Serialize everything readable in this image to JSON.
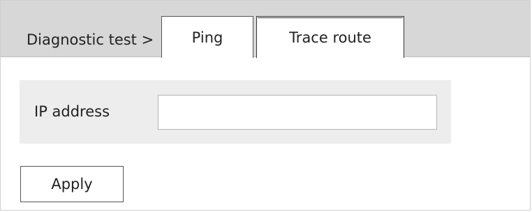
{
  "header": {
    "breadcrumb": "Diagnostic test >",
    "tabs": [
      {
        "label": "Ping",
        "active": false
      },
      {
        "label": "Trace route",
        "active": true
      }
    ]
  },
  "form": {
    "ip_label": "IP address",
    "ip_value": "",
    "ip_placeholder": ""
  },
  "actions": {
    "apply_label": "Apply"
  },
  "colors": {
    "tabbar_bg": "#d7d7d7",
    "panel_bg": "#ededed",
    "border": "#555555"
  }
}
